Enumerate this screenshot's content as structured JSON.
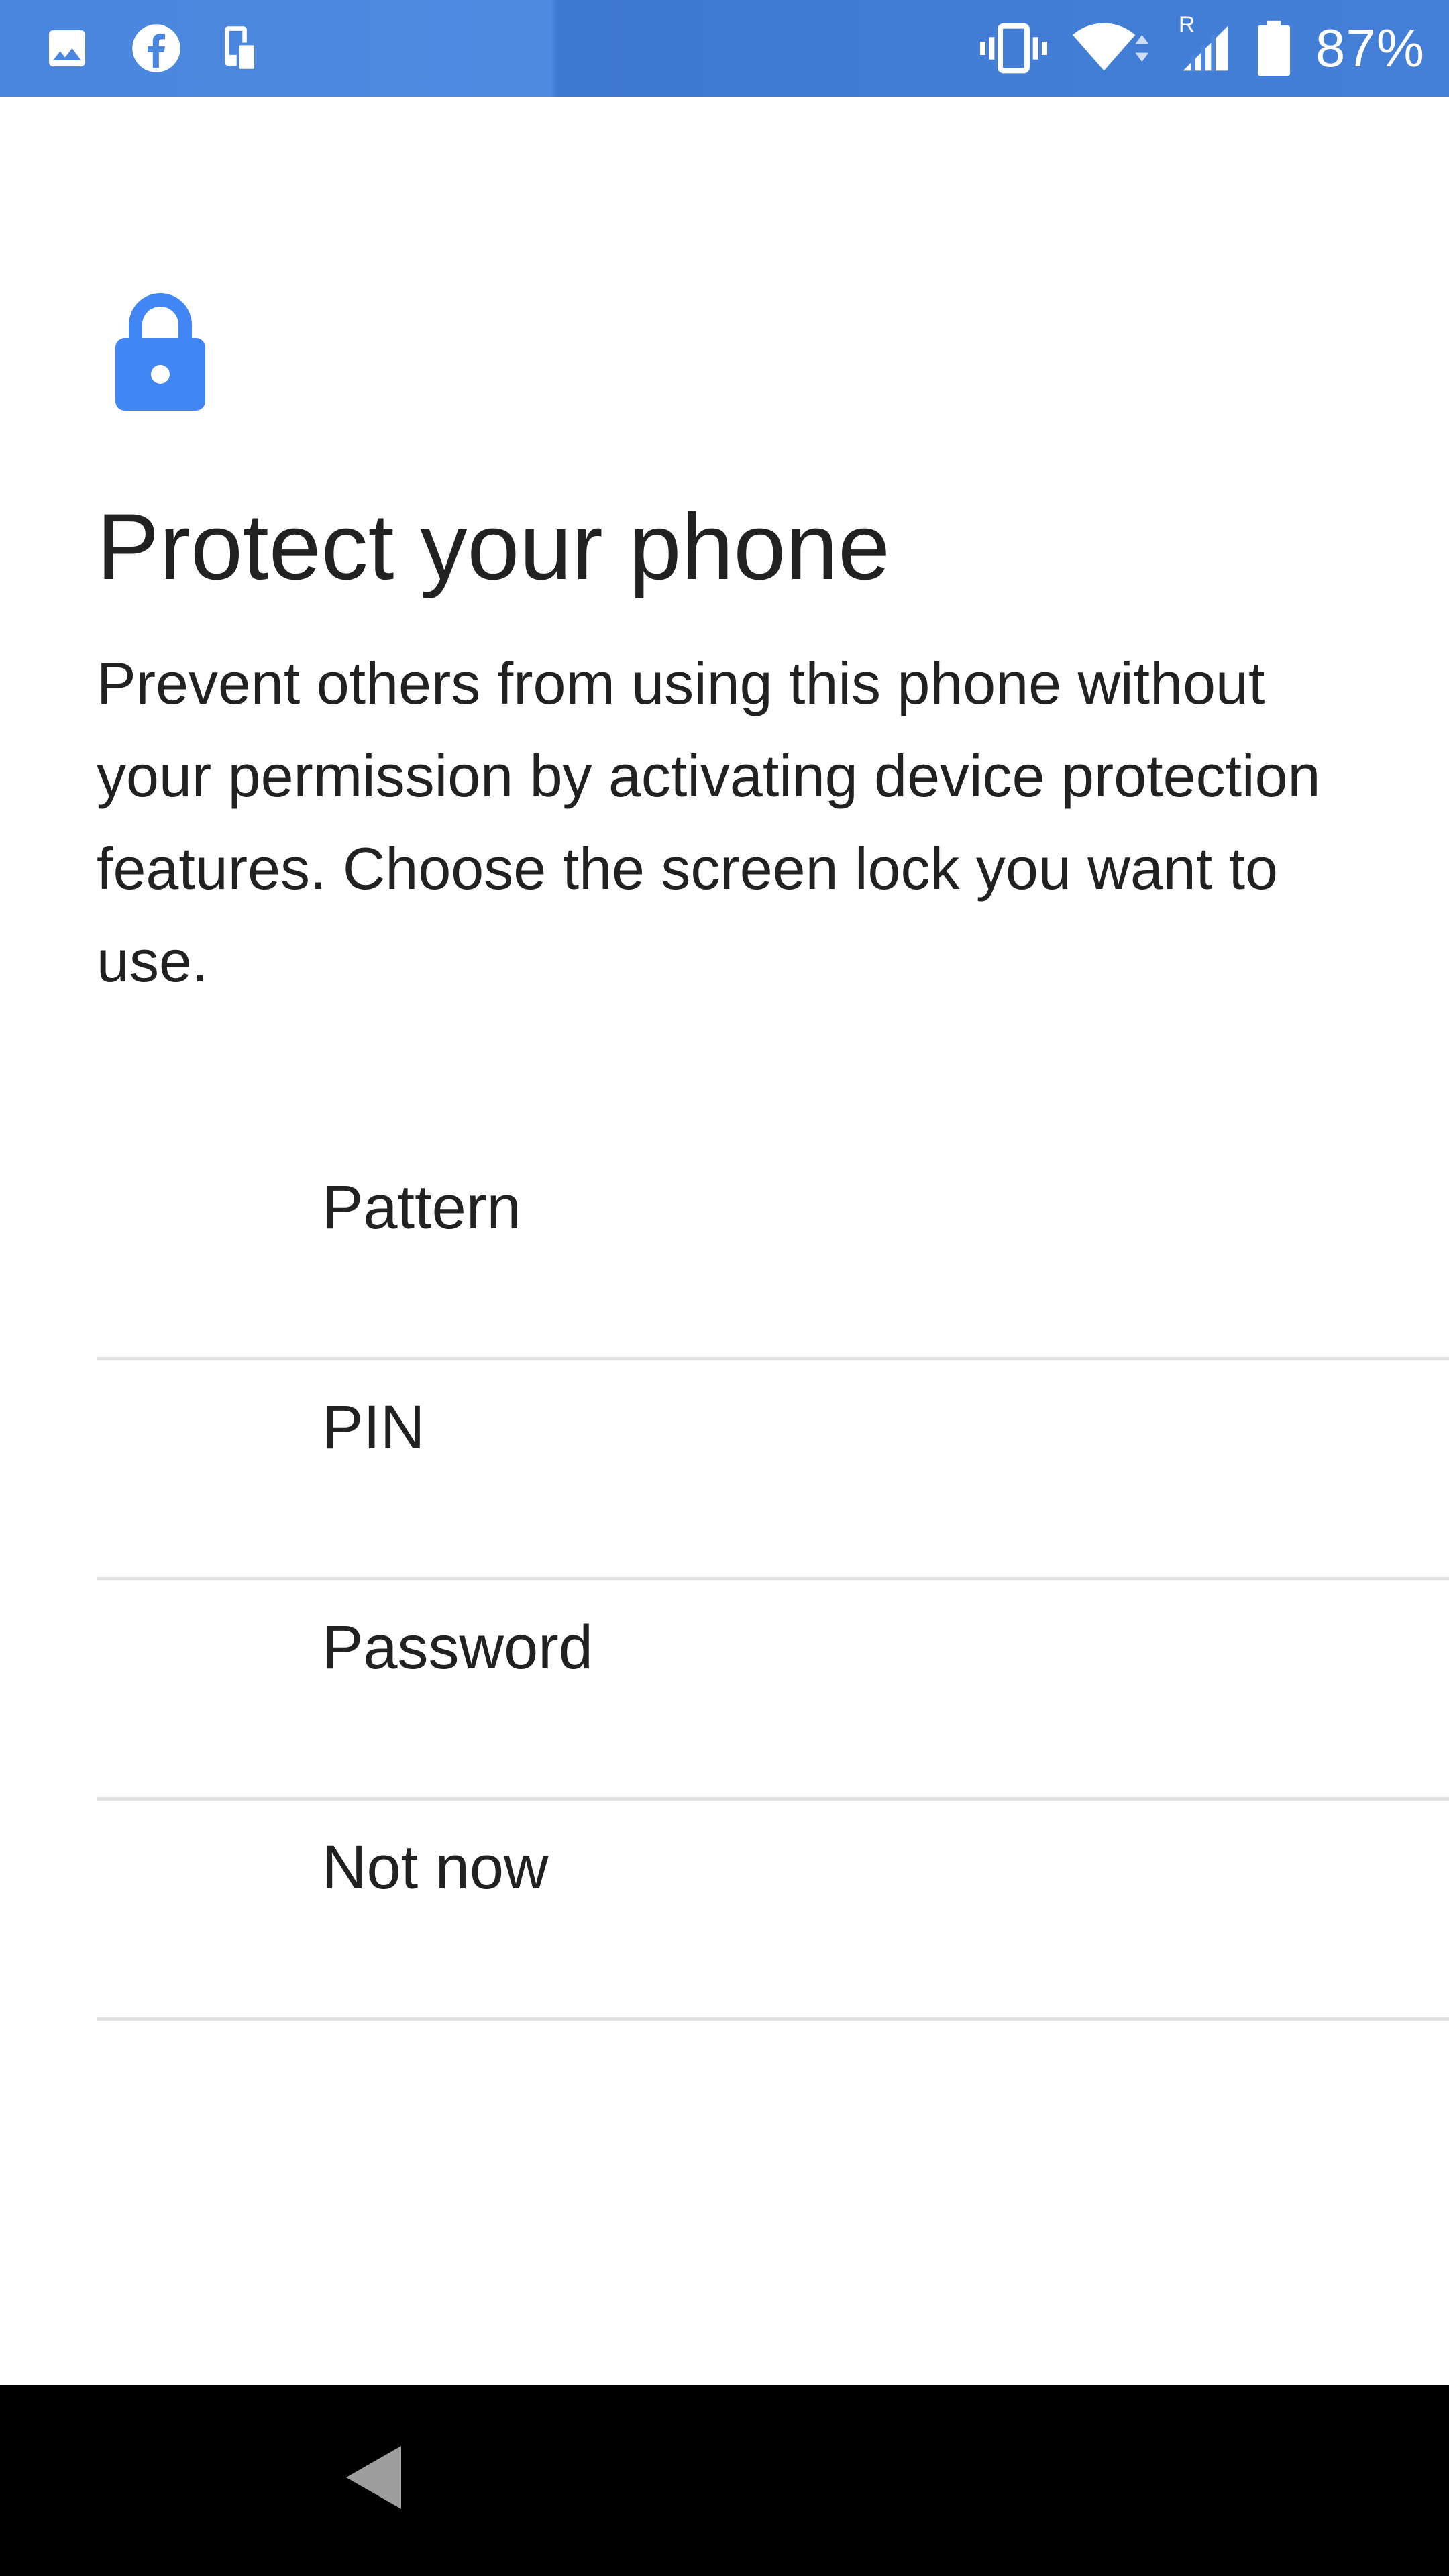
{
  "status_bar": {
    "icons_left": [
      "gallery-icon",
      "facebook-icon",
      "device-transfer-icon"
    ],
    "icons_right": [
      "vibrate-icon",
      "wifi-icon",
      "roaming-signal-icon",
      "battery-icon"
    ],
    "roaming_indicator": "R",
    "battery_percent": "87%"
  },
  "header": {
    "icon": "lock-icon",
    "accent_color": "#4285f4",
    "title": "Protect your phone",
    "description": "Prevent others from using this phone without your permission by activating device protection features. Choose the screen lock you want to use."
  },
  "options": [
    {
      "label": "Pattern"
    },
    {
      "label": "PIN"
    },
    {
      "label": "Password"
    },
    {
      "label": "Not now"
    }
  ],
  "nav_bar": {
    "back_icon": "back-icon"
  }
}
